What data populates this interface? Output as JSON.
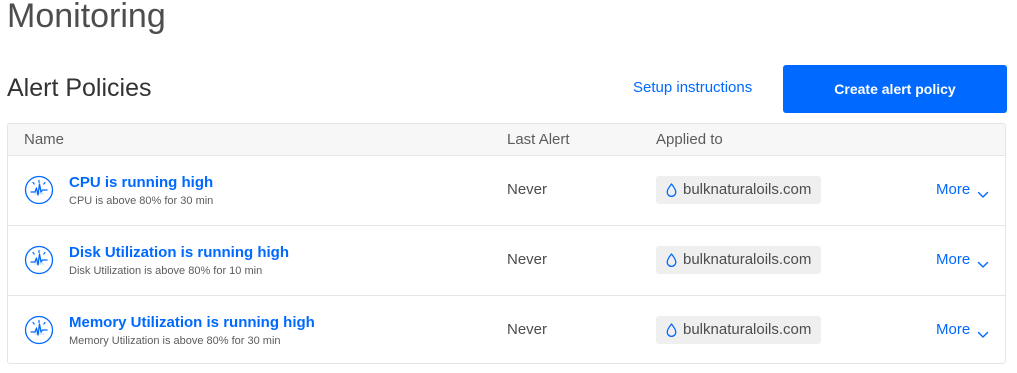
{
  "page": {
    "title": "Monitoring"
  },
  "section": {
    "title": "Alert Policies",
    "setup_link": "Setup instructions",
    "create_button": "Create alert policy"
  },
  "table": {
    "columns": [
      "Name",
      "Last Alert",
      "Applied to"
    ],
    "rows": [
      {
        "title": "CPU is running high",
        "description": "CPU is above 80% for 30 min",
        "last_alert": "Never",
        "applied_to": "bulknaturaloils.com",
        "more": "More",
        "icon": "policy-pulse-icon"
      },
      {
        "title": "Disk Utilization is running high",
        "description": "Disk Utilization is above 80% for 10 min",
        "last_alert": "Never",
        "applied_to": "bulknaturaloils.com",
        "more": "More",
        "icon": "policy-pulse-icon"
      },
      {
        "title": "Memory Utilization is running high",
        "description": "Memory Utilization is above 80% for 30 min",
        "last_alert": "Never",
        "applied_to": "bulknaturaloils.com",
        "more": "More",
        "icon": "policy-pulse-icon"
      }
    ]
  },
  "colors": {
    "accent": "#0069ff",
    "tag_bg": "#efefef",
    "header_bg": "#f7f7f7"
  }
}
